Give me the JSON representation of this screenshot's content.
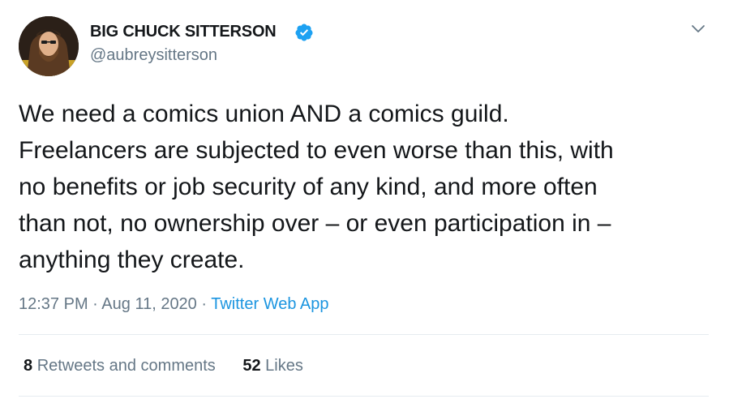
{
  "author": {
    "display_name": "BIG CHUCK SITTERSON",
    "handle": "@aubreysitterson",
    "verified": true
  },
  "tweet": {
    "text": "We need a comics union AND a comics guild.\nFreelancers are subjected to even worse than this, with\nno benefits or job security of any kind, and more often\nthan not, no ownership over – or even participation in –\nanything they create.",
    "time": "12:37 PM",
    "date_separator": "·",
    "date": "Aug 11, 2020",
    "source_separator": "·",
    "source": "Twitter Web App"
  },
  "stats": {
    "retweets_count": "8",
    "retweets_label": "Retweets and comments",
    "likes_count": "52",
    "likes_label": "Likes"
  },
  "colors": {
    "text": "#14171a",
    "secondary": "#657786",
    "accent": "#1b95e0",
    "divider": "#e6ecf0"
  },
  "icons": {
    "verified": "verified-badge-icon",
    "menu": "chevron-down-icon"
  }
}
